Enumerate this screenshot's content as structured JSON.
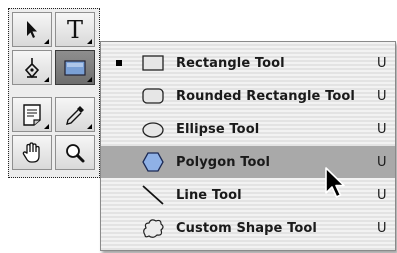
{
  "toolbox": {
    "tools": [
      {
        "name": "move-tool",
        "icon": "arrow-pointer-icon"
      },
      {
        "name": "type-tool",
        "icon": "type-T-icon",
        "glyph": "T"
      },
      {
        "name": "pen-tool",
        "icon": "pen-nib-icon"
      },
      {
        "name": "shape-tool",
        "icon": "rectangle-shape-icon",
        "active": true
      },
      {
        "name": "notes-tool",
        "icon": "note-icon"
      },
      {
        "name": "eyedropper-tool",
        "icon": "eyedropper-icon"
      },
      {
        "name": "hand-tool",
        "icon": "hand-icon"
      },
      {
        "name": "zoom-tool",
        "icon": "magnifier-icon"
      }
    ]
  },
  "menu": {
    "items": [
      {
        "label": "Rectangle Tool",
        "shortcut": "U",
        "icon": "rectangle-icon",
        "selected": true
      },
      {
        "label": "Rounded Rectangle Tool",
        "shortcut": "U",
        "icon": "rounded-rectangle-icon"
      },
      {
        "label": "Ellipse Tool",
        "shortcut": "U",
        "icon": "ellipse-icon"
      },
      {
        "label": "Polygon Tool",
        "shortcut": "U",
        "icon": "polygon-icon",
        "highlighted": true
      },
      {
        "label": "Line Tool",
        "shortcut": "U",
        "icon": "line-icon"
      },
      {
        "label": "Custom Shape Tool",
        "shortcut": "U",
        "icon": "custom-shape-icon"
      }
    ]
  },
  "colors": {
    "highlight": "#a9a9a9",
    "polygon_fill": "#8fb1e6"
  }
}
